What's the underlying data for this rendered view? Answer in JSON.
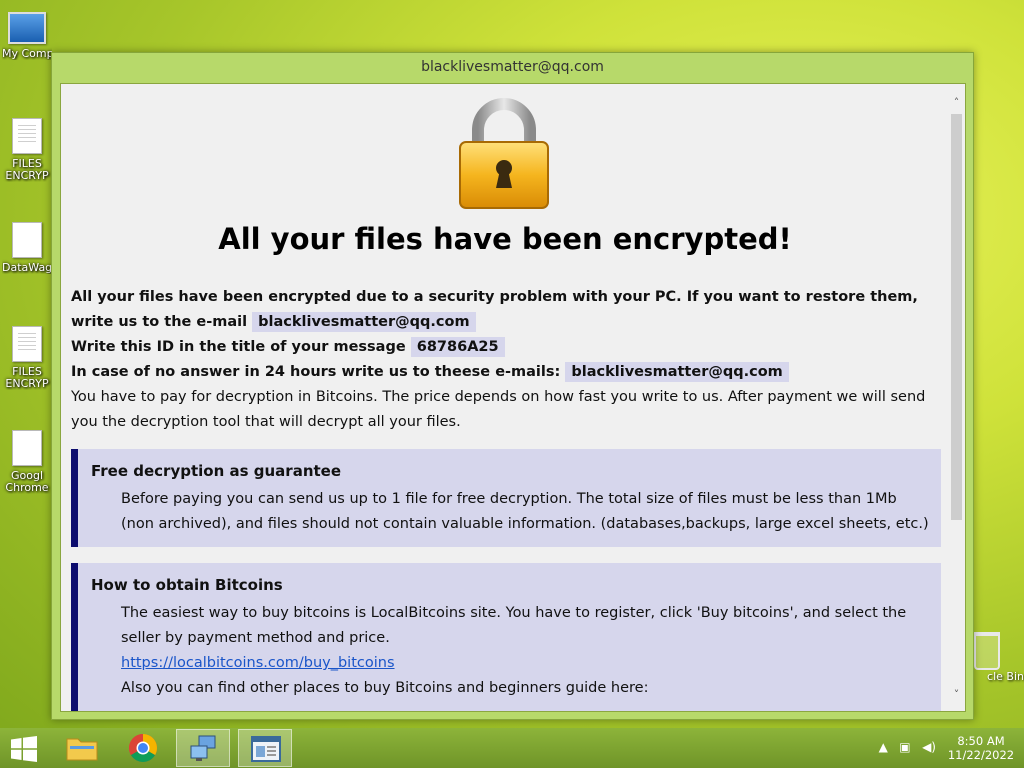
{
  "desktop": {
    "icons": [
      {
        "label": "My Comp"
      },
      {
        "label": "FILES ENCRYP"
      },
      {
        "label": "DataWag"
      },
      {
        "label": "FILES ENCRYP"
      },
      {
        "label": "Googl Chrome"
      }
    ],
    "recycle_label": "cle Bin"
  },
  "window": {
    "title": "blacklivesmatter@qq.com",
    "headline": "All your files have been encrypted!",
    "intro": {
      "line1": "All your files have been encrypted due to a security problem with your PC. If you want to restore them, write us to the e-mail",
      "email1": "blacklivesmatter@qq.com",
      "id_label": "Write this ID in the title of your message",
      "id_value": "68786A25",
      "no_answer": "In case of no answer in 24 hours write us to theese e-mails:",
      "email2": "blacklivesmatter@qq.com",
      "pay_text": "You have to pay for decryption in Bitcoins. The price depends on how fast you write to us. After payment we will send you the decryption tool that will decrypt all your files."
    },
    "guarantee": {
      "title": "Free decryption as guarantee",
      "text": "Before paying you can send us up to 1 file for free decryption. The total size of files must be less than 1Mb (non archived), and files should not contain valuable information. (databases,backups, large excel sheets, etc.)"
    },
    "bitcoins": {
      "title": "How to obtain Bitcoins",
      "text": "The easiest way to buy bitcoins is LocalBitcoins site. You have to register, click 'Buy bitcoins', and select the seller by payment method and price.",
      "link": "https://localbitcoins.com/buy_bitcoins",
      "more": "Also you can find other places to buy Bitcoins and beginners guide here:"
    }
  },
  "taskbar": {
    "time": "8:50 AM",
    "date": "11/22/2022"
  },
  "colors": {
    "accent_box": "#d6d6ec",
    "box_border": "#0c0c6e",
    "link": "#1a55c9"
  }
}
